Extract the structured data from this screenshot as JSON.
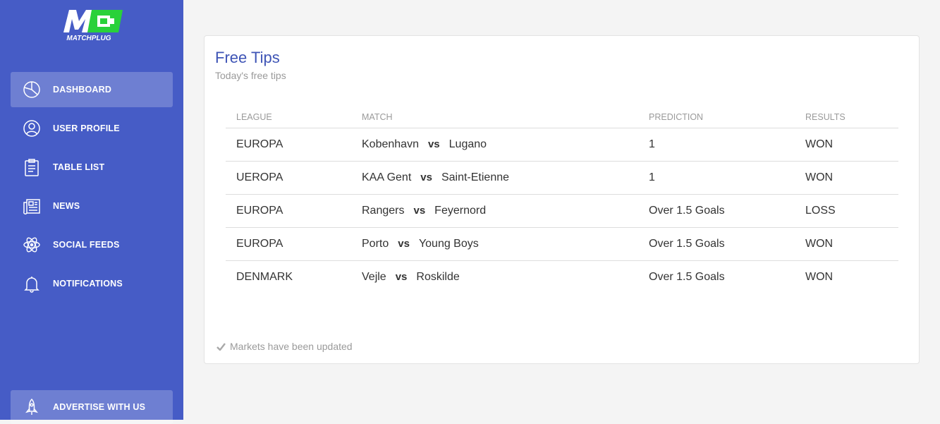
{
  "brand": {
    "logo_text": "MATCHPLUG",
    "accent": "#29d13a"
  },
  "sidebar": {
    "items": [
      {
        "label": "DASHBOARD",
        "icon": "pie-chart-icon",
        "active": true
      },
      {
        "label": "USER PROFILE",
        "icon": "user-icon",
        "active": false
      },
      {
        "label": "TABLE LIST",
        "icon": "clipboard-icon",
        "active": false
      },
      {
        "label": "NEWS",
        "icon": "newspaper-icon",
        "active": false
      },
      {
        "label": "SOCIAL FEEDS",
        "icon": "atom-icon",
        "active": false
      },
      {
        "label": "NOTIFICATIONS",
        "icon": "bell-icon",
        "active": false
      }
    ],
    "advertise": {
      "label": "ADVERTISE WITH US",
      "icon": "rocket-icon"
    }
  },
  "card": {
    "title": "Free Tips",
    "subtitle": "Today's free tips",
    "columns": [
      "LEAGUE",
      "MATCH",
      "PREDICTION",
      "RESULTS"
    ],
    "vs_label": "vs",
    "rows": [
      {
        "league": "EUROPA",
        "home": "Kobenhavn",
        "away": "Lugano",
        "prediction": "1",
        "result": "WON"
      },
      {
        "league": "UEROPA",
        "home": "KAA Gent",
        "away": "Saint-Etienne",
        "prediction": "1",
        "result": "WON"
      },
      {
        "league": "EUROPA",
        "home": "Rangers",
        "away": "Feyernord",
        "prediction": "Over 1.5 Goals",
        "result": "LOSS"
      },
      {
        "league": "EUROPA",
        "home": "Porto",
        "away": "Young Boys",
        "prediction": "Over 1.5 Goals",
        "result": "WON"
      },
      {
        "league": "DENMARK",
        "home": "Vejle",
        "away": "Roskilde",
        "prediction": "Over 1.5 Goals",
        "result": "WON"
      }
    ],
    "footer": "Markets have been updated"
  }
}
